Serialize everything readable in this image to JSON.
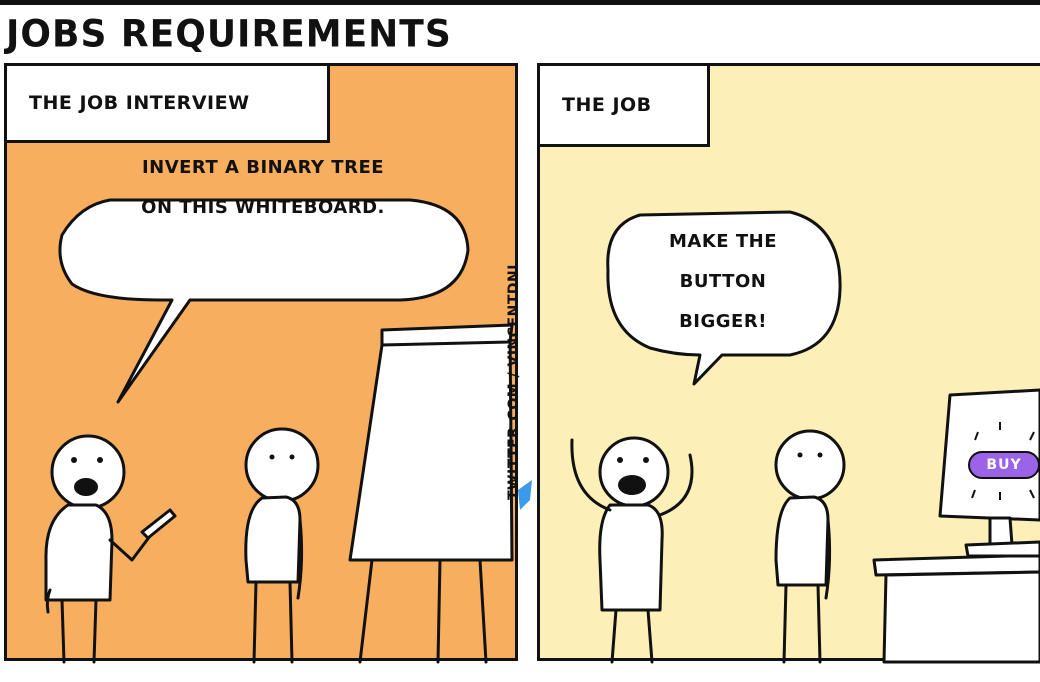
{
  "title": "JOBS REQUIREMENTS",
  "panels": {
    "left": {
      "caption": "THE JOB INTERVIEW",
      "speech_line1": "INVERT A BINARY TREE",
      "speech_line2": "ON THIS WHITEBOARD."
    },
    "right": {
      "caption": "THE JOB",
      "speech_line1": "MAKE THE",
      "speech_line2": "BUTTON",
      "speech_line3": "BIGGER!",
      "screen_button": "BUY"
    }
  },
  "credit": "TWITTER.COM / VINCENTDNL",
  "colors": {
    "left_panel_bg": "#f8ae5f",
    "right_panel_bg": "#fcefb8",
    "buy_button": "#9b63e8",
    "twitter_bird": "#3b9be8"
  },
  "icons": [
    "twitter-bird-icon"
  ]
}
